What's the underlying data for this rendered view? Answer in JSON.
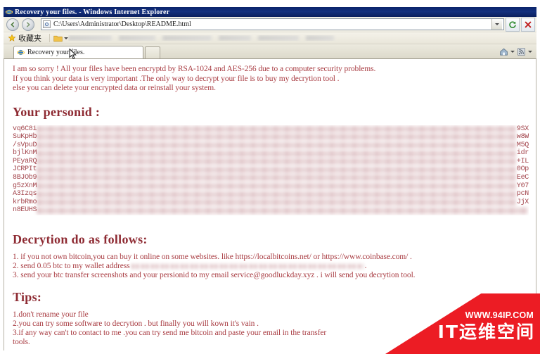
{
  "window": {
    "title": "Recovery your files. - Windows Internet Explorer",
    "ie_logo_icon": "ie-logo-icon"
  },
  "navbar": {
    "back_icon": "back-arrow-icon",
    "forward_icon": "forward-arrow-icon",
    "address_value": "C:\\Users\\Administrator\\Desktop\\README.html",
    "address_placeholder": "",
    "address_page_icon": "page-icon",
    "address_dropdown_icon": "chevron-down-icon",
    "refresh_icon": "refresh-icon",
    "stop_icon": "stop-icon"
  },
  "favorites": {
    "star_icon": "star-icon",
    "label": "收藏夹",
    "folder_icon": "folder-icon"
  },
  "tabstrip": {
    "tab_label": "Recovery your files.",
    "tab_icon": "ie-logo-icon",
    "new_tab_icon": "new-tab-icon",
    "home_icon": "home-icon",
    "feed_icon": "rss-feed-icon",
    "cursor_icon": "cursor-arrow-icon"
  },
  "page": {
    "intro": [
      "I am so sorry ! All your files have been encryptd by RSA-1024 and AES-256 due to a computer security problems.",
      "If you think your data is very important .The only way to decrypt your file is to buy my decrytion tool .",
      "else you can delete your encrypted data or reinstall your system."
    ],
    "personid_heading": "Your personid :",
    "personid_rows": [
      {
        "head": "vq6C8i",
        "tail": "9SX"
      },
      {
        "head": "SuKpHb",
        "tail": "w8W"
      },
      {
        "head": "/sVpuD",
        "tail": "M5Q"
      },
      {
        "head": "bjlKnM",
        "tail": "idr"
      },
      {
        "head": "PEyaRQ",
        "tail": "+IL"
      },
      {
        "head": "JCRPIt",
        "tail": "0Op"
      },
      {
        "head": "8BJOb9",
        "tail": "EeC"
      },
      {
        "head": "g5zXnM",
        "tail": "Y07"
      },
      {
        "head": "A3Izqs",
        "tail": "pcN"
      },
      {
        "head": "krbRmo",
        "tail": "JjX"
      },
      {
        "head": "n8EUHS",
        "tail": ""
      }
    ],
    "decryption_heading": "Decrytion do as follows:",
    "decryption_steps": [
      {
        "num": "1.",
        "text": "if you not own bitcoin,you can buy it online on some websites. like https://localbitcoins.net/ or https://www.coinbase.com/ ."
      },
      {
        "num": "2.",
        "before": "send 0.05 btc to my wallet address",
        "after": "."
      },
      {
        "num": "3.",
        "text": "send your btc transfer screenshots and your persionid to my email service@goodluckday.xyz . i will send you decrytion tool."
      }
    ],
    "tips_heading": "Tips:",
    "tips": [
      "1.don't rename your file",
      "2.you can try some software to decrytion . but finally you will kown it's vain .",
      "3.if any way can't to contact to me .you can try send me bitcoin and paste your email in the transfer",
      "tools."
    ]
  },
  "watermark": {
    "url": "WWW.94IP.COM",
    "brand": "IT运维空间",
    "color": "#ec1c24"
  },
  "colors": {
    "titlebar": "#0a246a",
    "text_red": "#a93d43",
    "heading_red": "#8e2b33"
  }
}
